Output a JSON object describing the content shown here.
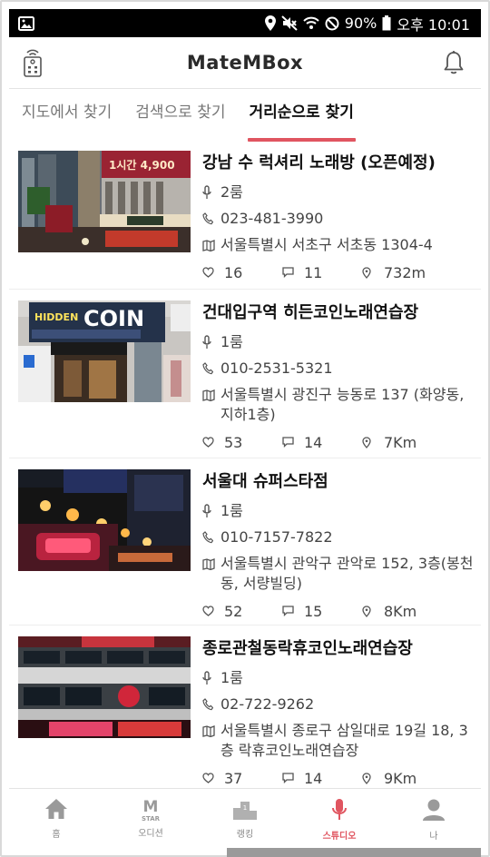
{
  "status_bar": {
    "battery": "90%",
    "time": "오후 10:01"
  },
  "header": {
    "title": "MateMBox"
  },
  "tabs": [
    {
      "label": "지도에서 찾기",
      "active": false
    },
    {
      "label": "검색으로 찾기",
      "active": false
    },
    {
      "label": "거리순으로 찾기",
      "active": true
    }
  ],
  "rooms": [
    {
      "name": "강남 수 럭셔리 노래방 (오픈예정)",
      "rooms": "2룸",
      "phone": "023-481-3990",
      "address": "서울특별시 서초구 서초동 1304-4",
      "likes": "16",
      "comments": "11",
      "distance": "732m"
    },
    {
      "name": "건대입구역 히든코인노래연습장",
      "rooms": "1룸",
      "phone": "010-2531-5321",
      "address": "서울특별시 광진구 능동로 137 (화양동, 지하1층)",
      "likes": "53",
      "comments": "14",
      "distance": "7Km"
    },
    {
      "name": "서울대 슈퍼스타점",
      "rooms": "1룸",
      "phone": "010-7157-7822",
      "address": "서울특별시 관악구 관악로 152, 3층(봉천동, 서량빌딩)",
      "likes": "52",
      "comments": "15",
      "distance": "8Km"
    },
    {
      "name": "종로관철동락휴코인노래연습장",
      "rooms": "1룸",
      "phone": "02-722-9262",
      "address": "서울특별시 종로구 삼일대로 19길 18, 3층 락휴코인노래연습장",
      "likes": "37",
      "comments": "14",
      "distance": "9Km"
    }
  ],
  "thumb_text": {
    "sign1": "1시간 4,900",
    "sign2": "HIDDEN",
    "sign3": "COIN"
  },
  "bottom_nav": [
    {
      "label": "홈",
      "icon": "home-icon",
      "active": false
    },
    {
      "label": "오디션",
      "icon": "mstar-icon",
      "active": false
    },
    {
      "label": "랭킹",
      "icon": "podium-icon",
      "active": false
    },
    {
      "label": "스튜디오",
      "icon": "microphone-icon",
      "active": true
    },
    {
      "label": "나",
      "icon": "person-icon",
      "active": false
    }
  ],
  "colors": {
    "accent": "#e05560",
    "inactive": "#888888"
  }
}
